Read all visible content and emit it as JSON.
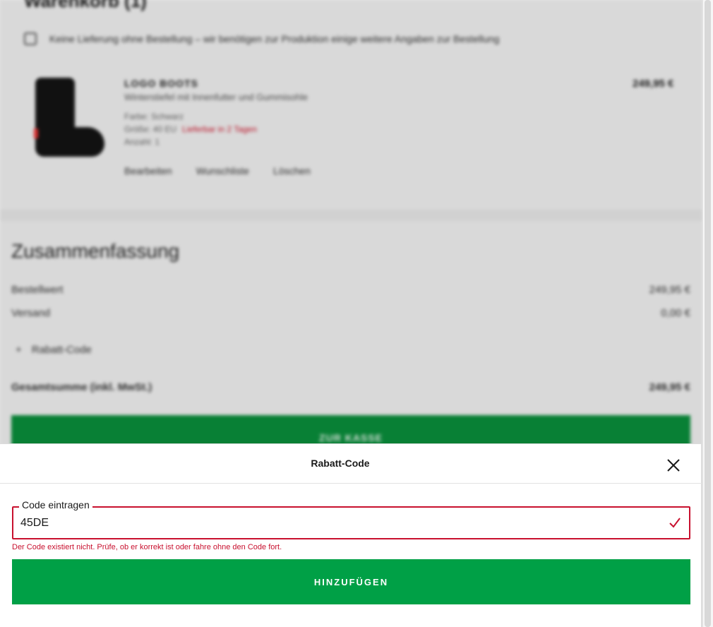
{
  "background_page": {
    "title": "Warenkorb (1)",
    "notice": "Keine Lieferung ohne Bestellung – wir benötigen zur Produktion einige weitere Angaben zur Bestellung",
    "product": {
      "name": "LOGO BOOTS",
      "subtitle": "Winterstiefel mit Innenfutter und Gummisohle",
      "color": "Farbe: Schwarz",
      "size": "Größe: 40 EU",
      "size_alert": "Lieferbar in 2 Tagen",
      "quantity": "Anzahl: 1",
      "price": "249,95 €",
      "actions": [
        "Bearbeiten",
        "Wunschliste",
        "Löschen"
      ]
    },
    "summary": {
      "title": "Zusammenfassung",
      "subtotal_label": "Bestellwert",
      "subtotal_value": "249,95 €",
      "shipping_label": "Versand",
      "shipping_value": "0,00 €",
      "promo_label": "Rabatt-Code",
      "total_label": "Gesamtsumme (inkl. MwSt.)",
      "total_value": "249,95 €",
      "checkout_label": "ZUR KASSE"
    }
  },
  "modal": {
    "title": "Rabatt-Code",
    "field_label": "Code eintragen",
    "field_value": "45DE",
    "error": "Der Code existiert nicht. Prüfe, ob er korrekt ist oder fahre ohne den Code fort.",
    "submit_label": "HINZUFÜGEN"
  },
  "colors": {
    "error_red": "#c8102e",
    "primary_green": "#00a046"
  },
  "icons": {
    "close": "close-icon",
    "valid": "checkmark-icon"
  }
}
